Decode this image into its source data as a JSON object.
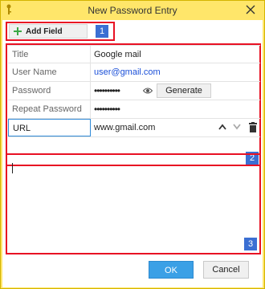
{
  "window": {
    "title": "New Password Entry"
  },
  "toolbar": {
    "add_field_label": "Add Field",
    "badge": "1"
  },
  "fields": {
    "badge": "2",
    "rows": [
      {
        "label": "Title",
        "value": "Google mail"
      },
      {
        "label": "User Name",
        "value": "user@gmail.com"
      },
      {
        "label": "Password",
        "value": "••••••••••",
        "action": "Generate"
      },
      {
        "label": "Repeat Password",
        "value": "••••••••••"
      },
      {
        "label": "URL",
        "value": "www.gmail.com"
      }
    ]
  },
  "notes": {
    "value": "",
    "badge": "3"
  },
  "footer": {
    "ok_label": "OK",
    "cancel_label": "Cancel"
  },
  "colors": {
    "title_bar": "#ffe66a",
    "highlight_box": "#e81123",
    "badge": "#3b6fd3",
    "ok_button": "#3ba0e6",
    "link": "#1a4fd8",
    "add_icon": "#3aa845"
  },
  "icons": {
    "app": "key-icon",
    "close": "close-icon",
    "add": "plus-icon",
    "show_password": "eye-icon",
    "move_up": "chevron-up-icon",
    "move_down": "chevron-down-icon",
    "delete": "trash-icon"
  }
}
